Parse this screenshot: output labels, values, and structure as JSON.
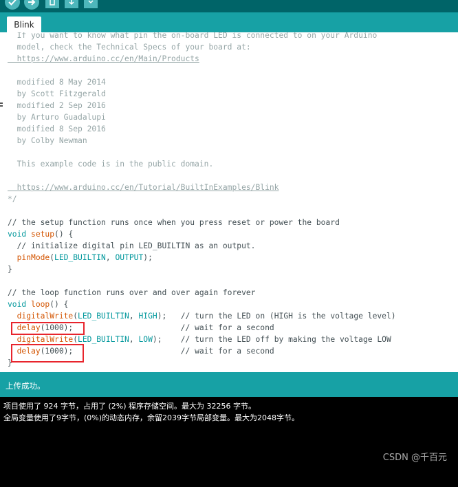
{
  "toolbar": {
    "buttons": [
      "verify-icon",
      "upload-icon",
      "new-icon",
      "open-icon",
      "save-icon"
    ]
  },
  "tabs": [
    {
      "label": "Blink"
    }
  ],
  "code_lines": [
    [
      {
        "t": "  If you want to know what pin the on-board LED is connected to on your Arduino",
        "c": "com"
      }
    ],
    [
      {
        "t": "  model, check the Technical Specs of your board at:",
        "c": "com"
      }
    ],
    [
      {
        "t": "  https://www.arduino.cc/en/Main/Products",
        "c": "com url"
      }
    ],
    [
      {
        "t": "",
        "c": ""
      }
    ],
    [
      {
        "t": "  modified 8 May 2014",
        "c": "com"
      }
    ],
    [
      {
        "t": "  by Scott Fitzgerald",
        "c": "com"
      }
    ],
    [
      {
        "t": "  modified 2 Sep 2016",
        "c": "com"
      }
    ],
    [
      {
        "t": "  by Arturo Guadalupi",
        "c": "com"
      }
    ],
    [
      {
        "t": "  modified 8 Sep 2016",
        "c": "com"
      }
    ],
    [
      {
        "t": "  by Colby Newman",
        "c": "com"
      }
    ],
    [
      {
        "t": "",
        "c": ""
      }
    ],
    [
      {
        "t": "  This example code is in the public domain.",
        "c": "com"
      }
    ],
    [
      {
        "t": "",
        "c": ""
      }
    ],
    [
      {
        "t": "  https://www.arduino.cc/en/Tutorial/BuiltInExamples/Blink",
        "c": "com url"
      }
    ],
    [
      {
        "t": "*/",
        "c": "com"
      }
    ],
    [
      {
        "t": "",
        "c": ""
      }
    ],
    [
      {
        "t": "// the setup function runs once when you press reset or power the board",
        "c": ""
      }
    ],
    [
      {
        "t": "void",
        "c": "kw"
      },
      {
        "t": " ",
        "c": ""
      },
      {
        "t": "setup",
        "c": "fn"
      },
      {
        "t": "() {",
        "c": ""
      }
    ],
    [
      {
        "t": "  // initialize digital pin LED_BUILTIN as an output.",
        "c": ""
      }
    ],
    [
      {
        "t": "  ",
        "c": ""
      },
      {
        "t": "pinMode",
        "c": "fn"
      },
      {
        "t": "(",
        "c": ""
      },
      {
        "t": "LED_BUILTIN",
        "c": "const"
      },
      {
        "t": ", ",
        "c": ""
      },
      {
        "t": "OUTPUT",
        "c": "const"
      },
      {
        "t": ");",
        "c": ""
      }
    ],
    [
      {
        "t": "}",
        "c": ""
      }
    ],
    [
      {
        "t": "",
        "c": ""
      }
    ],
    [
      {
        "t": "// the loop function runs over and over again forever",
        "c": ""
      }
    ],
    [
      {
        "t": "void",
        "c": "kw"
      },
      {
        "t": " ",
        "c": ""
      },
      {
        "t": "loop",
        "c": "fn"
      },
      {
        "t": "() {",
        "c": ""
      }
    ],
    [
      {
        "t": "  ",
        "c": ""
      },
      {
        "t": "digitalWrite",
        "c": "fn"
      },
      {
        "t": "(",
        "c": ""
      },
      {
        "t": "LED_BUILTIN",
        "c": "const"
      },
      {
        "t": ", ",
        "c": ""
      },
      {
        "t": "HIGH",
        "c": "const"
      },
      {
        "t": ");   // turn the LED on (HIGH is the voltage level)",
        "c": ""
      }
    ],
    [
      {
        "t": "  ",
        "c": ""
      },
      {
        "t": "delay",
        "c": "fn"
      },
      {
        "t": "(1000);                       // wait for a second",
        "c": ""
      }
    ],
    [
      {
        "t": "  ",
        "c": ""
      },
      {
        "t": "digitalWrite",
        "c": "fn"
      },
      {
        "t": "(",
        "c": ""
      },
      {
        "t": "LED_BUILTIN",
        "c": "const"
      },
      {
        "t": ", ",
        "c": ""
      },
      {
        "t": "LOW",
        "c": "const"
      },
      {
        "t": ");    // turn the LED off by making the voltage LOW",
        "c": ""
      }
    ],
    [
      {
        "t": "  ",
        "c": ""
      },
      {
        "t": "delay",
        "c": "fn"
      },
      {
        "t": "(1000);                       // wait for a second",
        "c": ""
      }
    ],
    [
      {
        "t": "}",
        "c": ""
      }
    ]
  ],
  "status": {
    "message": "上传成功。"
  },
  "console": {
    "lines": [
      "项目使用了 924 字节，占用了 (2%) 程序存储空间。最大为 32256 字节。",
      "全局变量使用了9字节，(0%)的动态内存，余留2039字节局部变量。最大为2048字节。"
    ]
  },
  "watermark": "CSDN @千百元",
  "colors": {
    "toolbar": "#006468",
    "tabbar": "#17a1a5",
    "keyword": "#00979c",
    "function": "#d35400",
    "comment": "#95a5a6",
    "highlight_box": "#e8242c"
  }
}
